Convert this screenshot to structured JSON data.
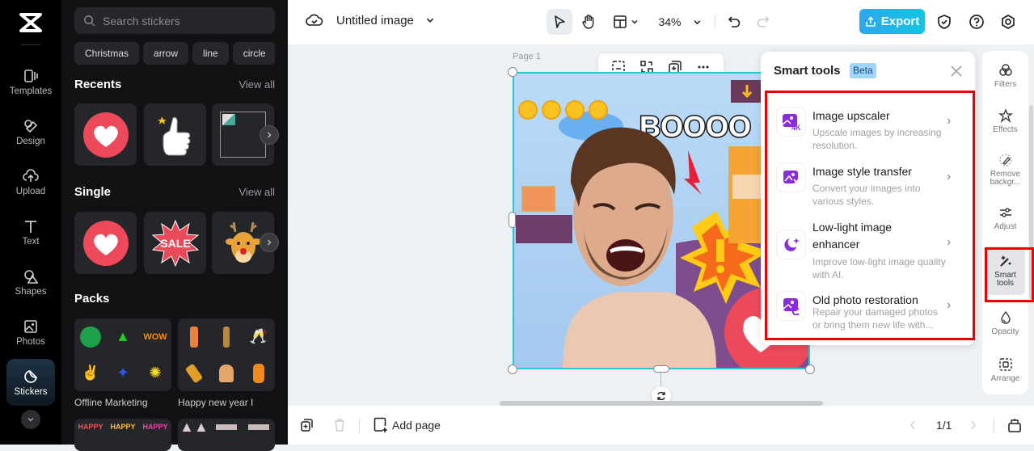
{
  "rail": {
    "items": [
      {
        "label": "Templates",
        "icon": "templates-icon"
      },
      {
        "label": "Design",
        "icon": "design-icon"
      },
      {
        "label": "Upload",
        "icon": "upload-icon"
      },
      {
        "label": "Text",
        "icon": "text-icon"
      },
      {
        "label": "Shapes",
        "icon": "shapes-icon"
      },
      {
        "label": "Photos",
        "icon": "photos-icon"
      },
      {
        "label": "Stickers",
        "icon": "stickers-icon",
        "active": true
      }
    ]
  },
  "stickers_panel": {
    "search_placeholder": "Search stickers",
    "chips": [
      "Christmas",
      "arrow",
      "line",
      "circle"
    ],
    "recents": {
      "title": "Recents",
      "view_all": "View all"
    },
    "single": {
      "title": "Single",
      "view_all": "View all",
      "sale_text": "SALE"
    },
    "packs": {
      "title": "Packs",
      "items": [
        {
          "label": "Offline Marketing"
        },
        {
          "label": "Happy new year I"
        }
      ]
    }
  },
  "topbar": {
    "doc_title": "Untitled image",
    "zoom": "34%",
    "export_label": "Export"
  },
  "canvas": {
    "page_label": "Page 1",
    "image_text": "BOOOO"
  },
  "smart_tools": {
    "title": "Smart tools",
    "badge": "Beta",
    "tools": [
      {
        "name": "Image upscaler",
        "desc": "Upscale images by increasing resolution.",
        "icon": "upscale-4k-icon"
      },
      {
        "name": "Image style transfer",
        "desc": "Convert your images into various styles.",
        "icon": "style-transfer-icon"
      },
      {
        "name": "Low-light image enhancer",
        "desc": "Improve low-light image quality with AI.",
        "icon": "moon-sparkle-icon"
      },
      {
        "name": "Old photo restoration",
        "desc": "Repair your damaged photos or bring them new life with...",
        "icon": "photo-restore-icon"
      }
    ]
  },
  "right_panel": {
    "items": [
      {
        "label": "Filters"
      },
      {
        "label": "Effects"
      },
      {
        "label": "Remove backgr..."
      },
      {
        "label": "Adjust"
      },
      {
        "label": "Smart tools",
        "active": true
      },
      {
        "label": "Opacity"
      },
      {
        "label": "Arrange"
      }
    ]
  },
  "bottombar": {
    "add_page": "Add page",
    "page_indicator": "1/1"
  },
  "colors": {
    "accent": "#13c5e0",
    "selection": "#29c4d6",
    "highlight": "#ee0000",
    "tool_icon": "#8a2be2"
  }
}
